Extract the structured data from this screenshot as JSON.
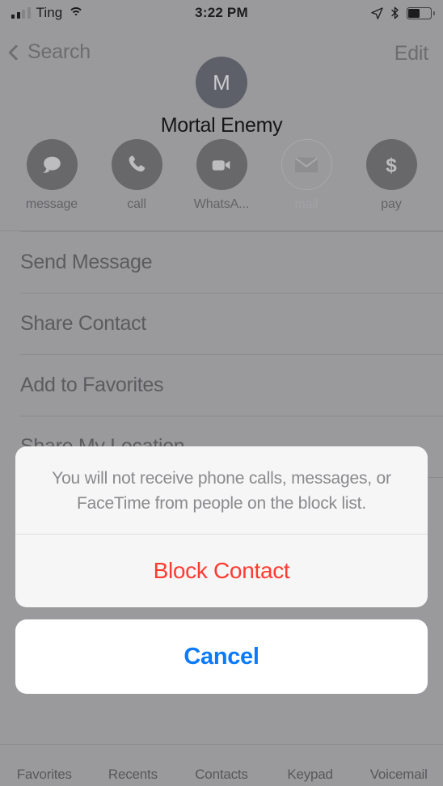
{
  "status_bar": {
    "carrier": "Ting",
    "time": "3:22 PM",
    "signal_icon": "cellular-bars-icon",
    "wifi_icon": "wifi-icon",
    "location_icon": "location-arrow-icon",
    "bluetooth_icon": "bluetooth-icon",
    "battery_icon": "battery-icon",
    "battery_percent": 45
  },
  "nav": {
    "back_label": "Search",
    "back_icon": "chevron-left-icon",
    "edit_label": "Edit",
    "avatar_initial": "M",
    "contact_name": "Mortal Enemy",
    "avatar_color": "#5d6069"
  },
  "actions": [
    {
      "label": "message",
      "icon": "message-bubble-icon",
      "enabled": true
    },
    {
      "label": "call",
      "icon": "phone-icon",
      "enabled": true
    },
    {
      "label": "WhatsA...",
      "icon": "video-camera-icon",
      "enabled": true
    },
    {
      "label": "mail",
      "icon": "envelope-icon",
      "enabled": false
    },
    {
      "label": "pay",
      "icon": "dollar-sign-icon",
      "enabled": true
    }
  ],
  "list": [
    {
      "label": "Send Message"
    },
    {
      "label": "Share Contact"
    },
    {
      "label": "Add to Favorites"
    },
    {
      "label": "Share My Location"
    }
  ],
  "action_sheet": {
    "message": "You will not receive phone calls, messages, or FaceTime from people on the block list.",
    "destructive_label": "Block Contact",
    "destructive_color": "#ff3b30",
    "cancel_label": "Cancel",
    "cancel_color": "#0a7bff"
  },
  "tabbar": [
    {
      "label": "Favorites"
    },
    {
      "label": "Recents"
    },
    {
      "label": "Contacts"
    },
    {
      "label": "Keypad"
    },
    {
      "label": "Voicemail"
    }
  ]
}
